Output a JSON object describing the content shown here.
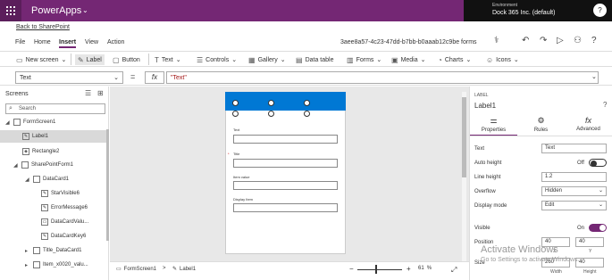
{
  "header": {
    "brand": "PowerApps",
    "env_label": "Environment",
    "env_value": "Dock 365 Inc. (default)",
    "avatar_glyph": "?"
  },
  "back_link": "Back to SharePoint",
  "menu": [
    "File",
    "Home",
    "Insert",
    "View",
    "Action"
  ],
  "app_id": "3aee8a57-4c23-47dd-b7bb-b0aaab12c9be forms",
  "ribbon": [
    {
      "label": "New screen",
      "icon": "new-screen-icon"
    },
    {
      "label": "Label",
      "icon": "label-icon"
    },
    {
      "label": "Button",
      "icon": "button-icon"
    },
    {
      "label": "Text",
      "icon": "text-icon"
    },
    {
      "label": "Controls",
      "icon": "controls-icon"
    },
    {
      "label": "Gallery",
      "icon": "gallery-icon"
    },
    {
      "label": "Data table",
      "icon": "data-table-icon"
    },
    {
      "label": "Forms",
      "icon": "forms-icon"
    },
    {
      "label": "Media",
      "icon": "media-icon"
    },
    {
      "label": "Charts",
      "icon": "charts-icon"
    },
    {
      "label": "Icons",
      "icon": "icons-icon"
    }
  ],
  "formula_bar": {
    "property": "Text",
    "equals": "=",
    "fx": "fx",
    "formula": "\"Text\""
  },
  "screens_pane": {
    "title": "Screens",
    "search_placeholder": "Search",
    "tree": [
      {
        "label": "FormScreen1"
      },
      {
        "label": "Label1"
      },
      {
        "label": "Rectangle2"
      },
      {
        "label": "SharePointForm1"
      },
      {
        "label": "DataCard1"
      },
      {
        "label": "StarVisible6"
      },
      {
        "label": "ErrorMessage6"
      },
      {
        "label": "DataCardValu..."
      },
      {
        "label": "DataCardKey6"
      },
      {
        "label": "Title_DataCard1"
      },
      {
        "label": "Item_x0020_valu..."
      }
    ]
  },
  "form_fields": [
    {
      "label": "Text"
    },
    {
      "label": "Title",
      "required": true
    },
    {
      "label": "Item value"
    },
    {
      "label": "Display Item"
    }
  ],
  "bottom_bar": {
    "screen": "FormScreen1",
    "control": "Label1",
    "zoom": "61",
    "zoom_unit": "%"
  },
  "properties": {
    "kind": "LABEL",
    "name": "Label1",
    "tabs": [
      "Properties",
      "Rules",
      "Advanced"
    ],
    "rows": {
      "text_label": "Text",
      "text_value": "Text",
      "auto_height_label": "Auto height",
      "auto_height_value": "Off",
      "line_height_label": "Line height",
      "line_height_value": "1.2",
      "overflow_label": "Overflow",
      "overflow_value": "Hidden",
      "display_mode_label": "Display mode",
      "display_mode_value": "Edit",
      "visible_label": "Visible",
      "visible_value": "On",
      "position_label": "Position",
      "position_x": "40",
      "position_y": "40",
      "x_label": "X",
      "y_label": "Y",
      "size_label": "Size",
      "size_w": "260",
      "size_h": "40",
      "width_label": "Width",
      "height_label": "Height"
    }
  },
  "watermark": {
    "line1": "Activate Windows",
    "line2": "Go to Settings to activate Windows."
  },
  "colors": {
    "brand": "#742774",
    "header_blue": "#0078d4",
    "toggle_on": "#742774"
  }
}
